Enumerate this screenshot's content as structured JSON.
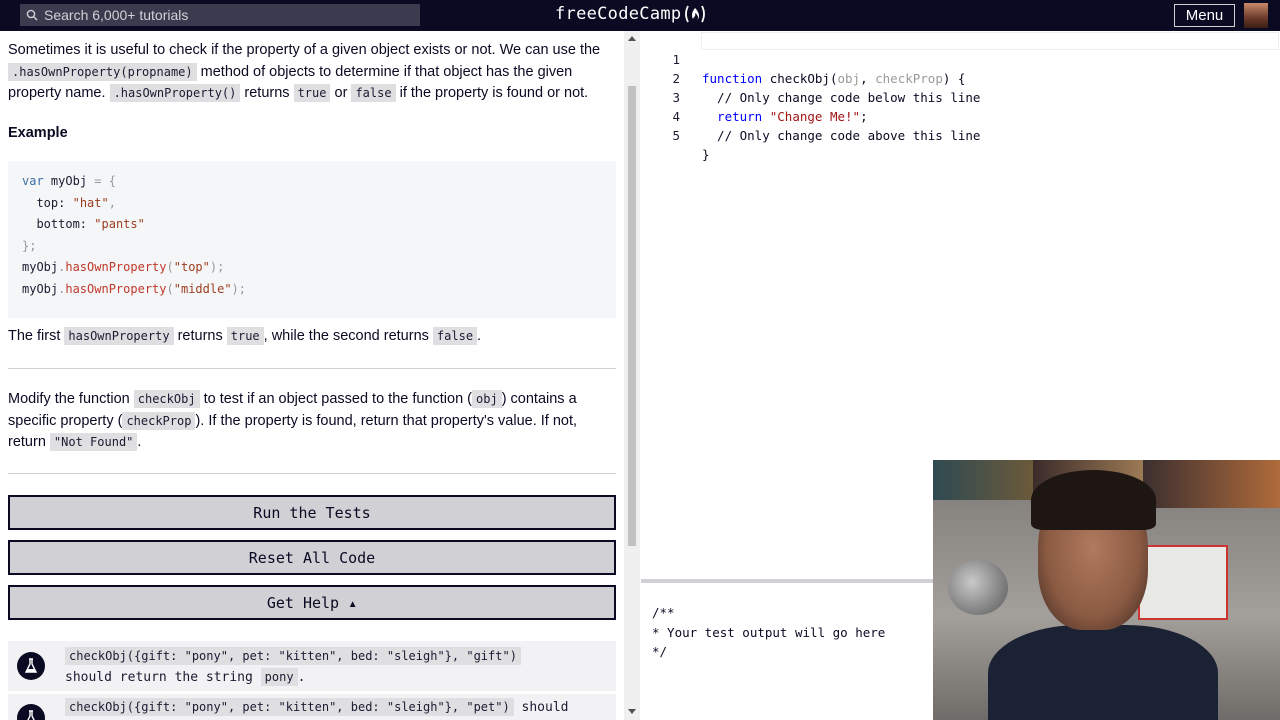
{
  "nav": {
    "search_placeholder": "Search 6,000+ tutorials",
    "logo_text": "freeCodeCamp",
    "menu_label": "Menu"
  },
  "description": {
    "p1_a": "Sometimes it is useful to check if the property of a given object exists or not. We can use the",
    "p1_code1": ".hasOwnProperty(propname)",
    "p1_b": " method of objects to determine if that object has the given property name. ",
    "p1_code2": ".hasOwnProperty()",
    "p1_c": " returns ",
    "p1_code3": "true",
    "p1_d": " or ",
    "p1_code4": "false",
    "p1_e": " if the property is found or not.",
    "example_heading": "Example",
    "code_lines": [
      "var myObj = {",
      "  top: \"hat\",",
      "  bottom: \"pants\"",
      "};",
      "myObj.hasOwnProperty(\"top\");",
      "myObj.hasOwnProperty(\"middle\");"
    ],
    "p2_a": "The first ",
    "p2_code1": "hasOwnProperty",
    "p2_b": " returns ",
    "p2_code2": "true",
    "p2_c": ", while the second returns ",
    "p2_code3": "false",
    "p2_d": ".",
    "p3_a": "Modify the function ",
    "p3_code1": "checkObj",
    "p3_b": " to test if an object passed to the function (",
    "p3_code2": "obj",
    "p3_c": ") contains a specific property (",
    "p3_code3": "checkProp",
    "p3_d": "). If the property is found, return that property's value. If not, return ",
    "p3_code4": "\"Not Found\"",
    "p3_e": "."
  },
  "buttons": {
    "run": "Run the Tests",
    "reset": "Reset All Code",
    "help": "Get Help ▴"
  },
  "tests": [
    {
      "code": "checkObj({gift: \"pony\", pet: \"kitten\", bed: \"sleigh\"}, \"gift\")",
      "text_a": "should return the string ",
      "text_code": "pony",
      "text_b": "."
    },
    {
      "code": "checkObj({gift: \"pony\", pet: \"kitten\", bed: \"sleigh\"}, \"pet\")",
      "text_a": " should"
    }
  ],
  "editor": {
    "line_numbers": [
      "1",
      "2",
      "3",
      "4",
      "5"
    ],
    "l1_kw": "function",
    "l1_name": " checkObj(",
    "l1_p1": "obj",
    "l1_sep": ", ",
    "l1_p2": "checkProp",
    "l1_end": ") {",
    "l2": "  // Only change code below this line",
    "l3_kw": "  return",
    "l3_str": " \"Change Me!\"",
    "l3_end": ";",
    "l4": "  // Only change code above this line",
    "l5": "}"
  },
  "output": {
    "text": "/**\n* Your test output will go here\n*/"
  }
}
